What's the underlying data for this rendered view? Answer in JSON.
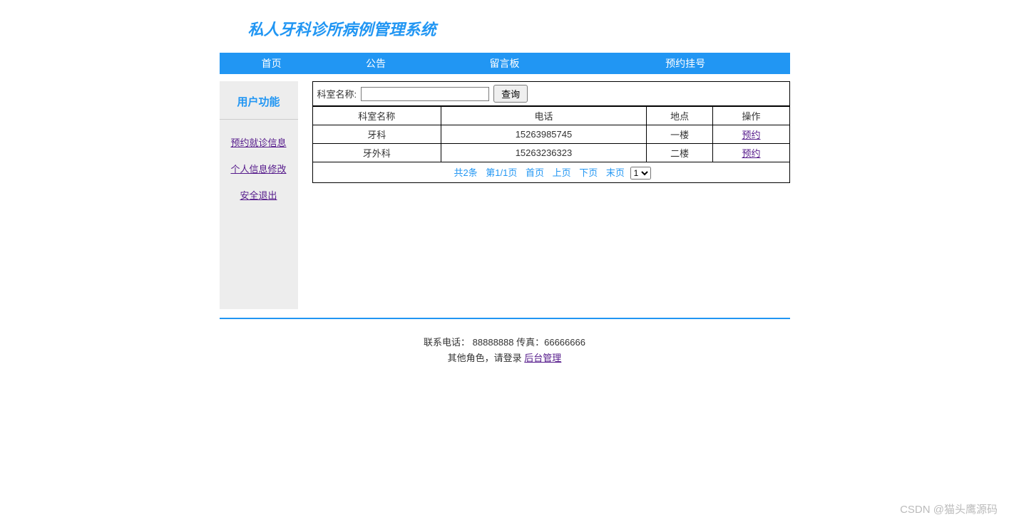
{
  "header": {
    "title": "私人牙科诊所病例管理系统"
  },
  "nav": {
    "items": [
      "首页",
      "公告",
      "留言板",
      "预约挂号"
    ]
  },
  "sidebar": {
    "title": "用户功能",
    "links": [
      "预约就诊信息",
      "个人信息修改",
      "安全退出"
    ]
  },
  "search": {
    "label": "科室名称:",
    "button": "查询",
    "value": ""
  },
  "table": {
    "headers": [
      "科室名称",
      "电话",
      "地点",
      "操作"
    ],
    "rows": [
      {
        "name": "牙科",
        "phone": "15263985745",
        "location": "一楼",
        "action": "预约"
      },
      {
        "name": "牙外科",
        "phone": "15263236323",
        "location": "二楼",
        "action": "预约"
      }
    ]
  },
  "pager": {
    "summary": "共2条",
    "page": "第1/1页",
    "first": "首页",
    "prev": "上页",
    "next": "下页",
    "last": "末页",
    "select": "1"
  },
  "footer": {
    "line1": "联系电话： 88888888 传真：66666666",
    "line2_prefix": "其他角色，请登录 ",
    "line2_link": "后台管理"
  },
  "watermark": "CSDN @猫头鹰源码"
}
